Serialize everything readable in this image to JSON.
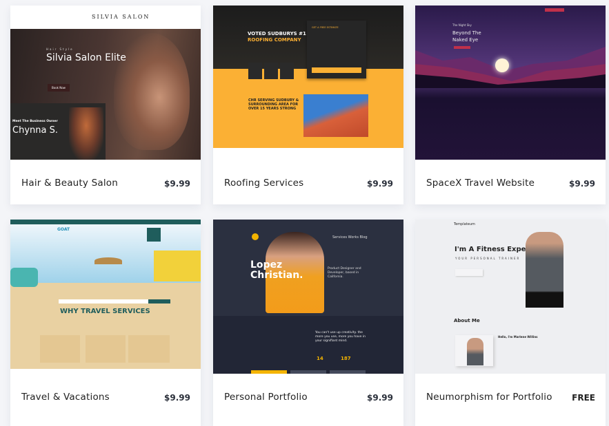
{
  "cards": [
    {
      "title": "Hair & Beauty Salon",
      "price": "$9.99",
      "thumb": {
        "logo": "SILVIA SALON",
        "eyebrow": "Hair Style",
        "headline": "Silvia Salon  Elite",
        "button": "Book Now",
        "sub": "Meet The Business Owner",
        "name": "Chynna S."
      }
    },
    {
      "title": "Roofing Services",
      "price": "$9.99",
      "thumb": {
        "headline1": "VOTED SUDBURYS #1",
        "headline2": "ROOFING COMPANY",
        "form_title": "GET A FREE ESTIMATE",
        "section": "CHR SERVING SUDBURY & SURROUNDING AREA FOR OVER 15 YEARS STRONG"
      }
    },
    {
      "title": "SpaceX Travel Website",
      "price": "$9.99",
      "thumb": {
        "eyebrow": "The Night Sky",
        "headline1": "Beyond The",
        "headline2": "Naked Eye"
      }
    },
    {
      "title": "Travel & Vacations",
      "price": "$9.99",
      "thumb": {
        "logo": "GOAT",
        "headline": "WHY TRAVEL SERVICES"
      }
    },
    {
      "title": "Personal Portfolio",
      "price": "$9.99",
      "thumb": {
        "nav": "Services  Works  Blog",
        "name1": "Lopez",
        "name2": "Christian.",
        "role": "Product Designer and Developer, based in California.",
        "quote": "You can't use up creativity. the more you use, more you have in your signifiant mind.",
        "stat1": "14",
        "stat2": "187"
      }
    },
    {
      "title": "Neumorphism for Portfolio",
      "price": "FREE",
      "thumb": {
        "logo": "Templateum",
        "headline": "I'm A Fitness Expert",
        "sub": "YOUR PERSONAL TRAINER",
        "about": "About Me",
        "hello": "Hello, I'm Marlene Willins"
      }
    }
  ],
  "colors": {
    "price": "#2a2f3a",
    "roof_yellow": "#fbb034",
    "space_purple": "#2a1545",
    "portfolio_dark": "#262b3a",
    "travel_teal": "#1f5d5c"
  }
}
